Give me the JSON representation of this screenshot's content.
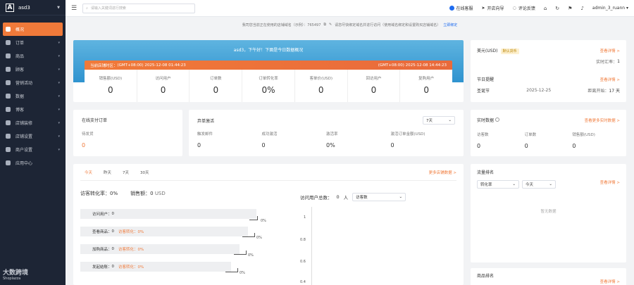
{
  "sidebar": {
    "brand": "asd3",
    "logo": "A",
    "items": [
      {
        "label": "概况",
        "icon": "home-icon",
        "active": true
      },
      {
        "label": "订单",
        "icon": "order-icon"
      },
      {
        "label": "商品",
        "icon": "goods-icon"
      },
      {
        "label": "顾客",
        "icon": "customer-icon"
      },
      {
        "label": "营销活动",
        "icon": "marketing-icon"
      },
      {
        "label": "数据",
        "icon": "data-icon"
      },
      {
        "label": "博客",
        "icon": "blog-icon"
      },
      {
        "label": "店铺装修",
        "icon": "decor-icon"
      },
      {
        "label": "店铺设置",
        "icon": "store-settings-icon"
      },
      {
        "label": "商户设置",
        "icon": "merchant-settings-icon"
      },
      {
        "label": "应用中心",
        "icon": "app-center-icon"
      }
    ],
    "watermark": "大数跨境",
    "watermark_sub": "Shoplazza"
  },
  "topbar": {
    "search_placeholder": "请输入关键词进行搜索",
    "online_service": "在线客服",
    "open_guide": "开店向导",
    "feedback": "评论反馈",
    "user": "admin_3_ruann"
  },
  "notice": {
    "text1": "我司您当前正在使用的店铺域名（示例）：765497",
    "text2": "请您尽快绑定域名并进行访问（使用域名绑定和设置购买店铺域名）",
    "link": "立即绑定"
  },
  "banner": {
    "title": "asd3，下午好！下面是今日数据概况",
    "local_time_label": "当前店铺时区：",
    "local_time": "(GMT+08:00) 2025-12-08 01:44:23",
    "right_time": "(GMT+08:00) 2025-12-08 14:44:23",
    "stats": [
      {
        "label": "销售额(USD)",
        "value": "0"
      },
      {
        "label": "访问用户",
        "value": "0"
      },
      {
        "label": "订单数",
        "value": "0"
      },
      {
        "label": "订单转化率",
        "value": "0%"
      },
      {
        "label": "客单价(USD)",
        "value": "0"
      },
      {
        "label": "回访用户",
        "value": "0"
      },
      {
        "label": "复购用户",
        "value": "0"
      }
    ]
  },
  "pay": {
    "title": "在线支付订单",
    "label": "待发货",
    "value": "0"
  },
  "bargain": {
    "title": "弃单激活",
    "period": "7天",
    "cols": [
      {
        "label": "触发邮件",
        "value": "0"
      },
      {
        "label": "成功激活",
        "value": "0"
      },
      {
        "label": "激活率",
        "value": "0%"
      },
      {
        "label": "激活订单金额(USD)",
        "value": "0"
      }
    ]
  },
  "analysis": {
    "tabs": [
      "今天",
      "昨天",
      "7天",
      "30天"
    ],
    "more": "更多店铺数据 >",
    "conv_label": "访客转化率：",
    "conv_value": "0%",
    "sales_label": "销售额：",
    "sales_value": "0",
    "sales_unit": "USD",
    "funnel": [
      {
        "label": "访问用户：",
        "value": "0",
        "conv": "",
        "pct": "0%"
      },
      {
        "label": "查看商品：",
        "value": "0",
        "conv": "访客转化：0%",
        "pct": "0%"
      },
      {
        "label": "加购商品：",
        "value": "0",
        "conv": "访客转化：0%",
        "pct": "0%"
      },
      {
        "label": "发起结账：",
        "value": "0",
        "conv": "访客转化：0%",
        "pct": "0%"
      }
    ],
    "visitors_label": "访问用户总数：",
    "visitors_value": "0",
    "visitors_unit": "人",
    "visitors_select": "访客数",
    "y_ticks": [
      "1",
      "0.8",
      "0.6",
      "0.4"
    ]
  },
  "realtime_currency": {
    "currency": "美元(USD)",
    "badge": "默认货币",
    "link": "查看详情 >",
    "rate_label": "实时汇率：",
    "rate_value": "1",
    "holiday_title": "节日提醒",
    "holiday_link": "查看详情 >",
    "holiday_name": "圣诞节",
    "holiday_date": "2025-12-25",
    "holiday_countdown_label": "距离开始：",
    "holiday_countdown": "17 天"
  },
  "realtime": {
    "title": "实时数据",
    "link": "查看更多实时数据 >",
    "cols": [
      {
        "label": "访客数",
        "value": "0"
      },
      {
        "label": "订单数",
        "value": "0"
      },
      {
        "label": "销售额(USD)",
        "value": "0"
      }
    ]
  },
  "traffic": {
    "title": "流量排名",
    "link": "查看详情 >",
    "select1": "转化率",
    "select2": "今天",
    "empty": "暂无数据"
  },
  "goods_rank": {
    "title": "商品排名",
    "link": "查看详情 >"
  }
}
